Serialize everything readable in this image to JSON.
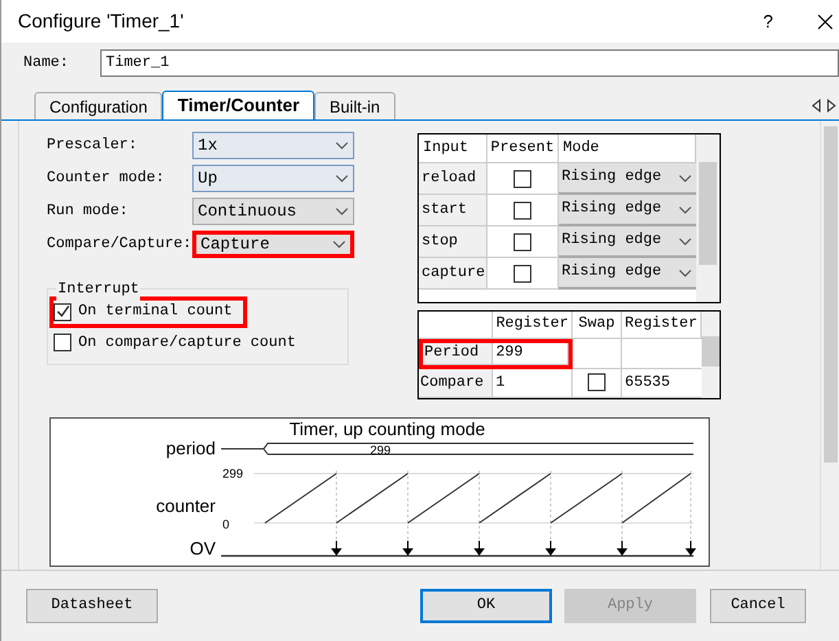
{
  "window": {
    "title": "Configure 'Timer_1'",
    "help": "?"
  },
  "name_field": {
    "label": "Name:",
    "value": "Timer_1"
  },
  "tabs": [
    {
      "label": "Configuration",
      "selected": false
    },
    {
      "label": "Timer/Counter",
      "selected": true
    },
    {
      "label": "Built-in",
      "selected": false
    }
  ],
  "settings": [
    {
      "label": "Prescaler:",
      "value": "1x",
      "focused": true,
      "highlighted": false
    },
    {
      "label": "Counter mode:",
      "value": "Up",
      "focused": true,
      "highlighted": false
    },
    {
      "label": "Run mode:",
      "value": "Continuous",
      "focused": false,
      "highlighted": false
    },
    {
      "label": "Compare/Capture:",
      "value": "Capture",
      "focused": false,
      "highlighted": true
    }
  ],
  "interrupt": {
    "title": "Interrupt",
    "options": [
      {
        "label": "On terminal count",
        "checked": true,
        "highlighted": true
      },
      {
        "label": "On compare/capture count",
        "checked": false,
        "highlighted": false
      }
    ]
  },
  "inputs_table": {
    "columns": [
      "Input",
      "Present",
      "Mode"
    ],
    "rows": [
      {
        "input": "reload",
        "present": false,
        "mode": "Rising edge"
      },
      {
        "input": "start",
        "present": false,
        "mode": "Rising edge"
      },
      {
        "input": "stop",
        "present": false,
        "mode": "Rising edge"
      },
      {
        "input": "capture",
        "present": false,
        "mode": "Rising edge"
      }
    ]
  },
  "registers_table": {
    "columns": [
      "Register",
      "Swap",
      "Register"
    ],
    "rows": [
      {
        "name": "Period",
        "register": "299",
        "highlighted": true
      },
      {
        "name": "Compare",
        "register": "1",
        "swap": {
          "checked": false
        },
        "column_3": "65535",
        "highlighted": false
      }
    ]
  },
  "diagram": {
    "title": "Timer, up counting mode",
    "period_label": "period",
    "period_value": "299",
    "counter_label": "counter",
    "max_label": "299",
    "min_label": "0",
    "ov_label": "OV"
  },
  "buttons": [
    {
      "label": "Datasheet",
      "kind": "normal"
    },
    {
      "label": "OK",
      "kind": "default"
    },
    {
      "label": "Apply",
      "kind": "disabled"
    },
    {
      "label": "Cancel",
      "kind": "normal"
    }
  ]
}
